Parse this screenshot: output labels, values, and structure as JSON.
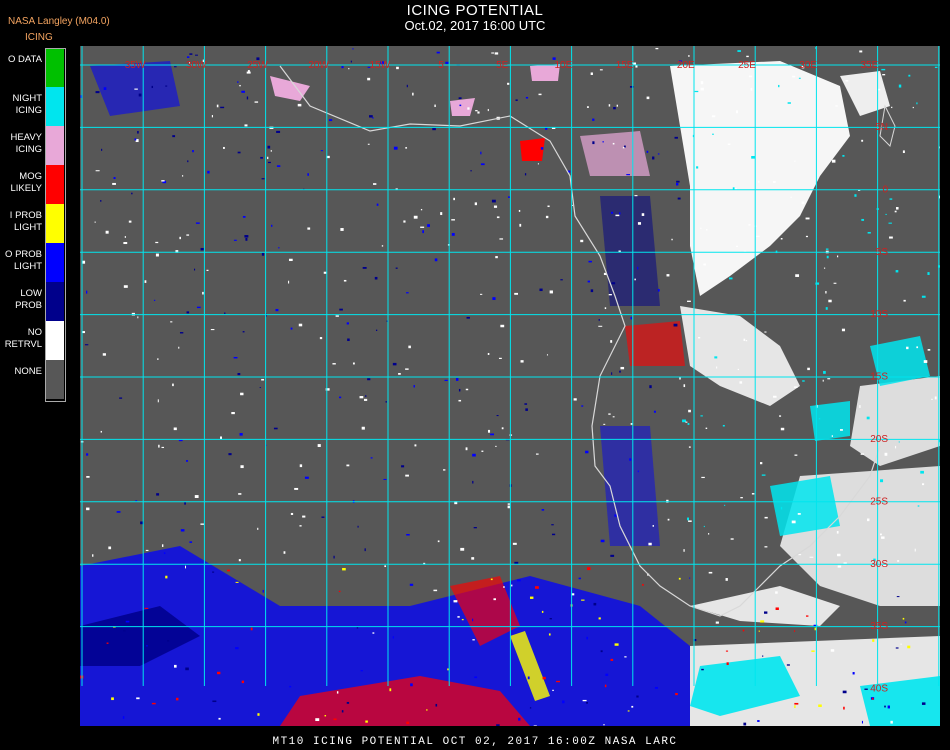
{
  "header": {
    "title": "ICING POTENTIAL",
    "subtitle": "Oct.02, 2017 16:00 UTC",
    "brand": "NASA Langley (M04.0)",
    "product": "ICING"
  },
  "legend": [
    {
      "label": "O DATA",
      "color": "#00c000"
    },
    {
      "label": "NIGHT\nICING",
      "color": "#00e5ee"
    },
    {
      "label": "HEAVY\nICING",
      "color": "#e8a8d8"
    },
    {
      "label": "MOG\nLIKELY",
      "color": "#ff0000"
    },
    {
      "label": "I PROB\nLIGHT",
      "color": "#ffff00"
    },
    {
      "label": "O PROB\nLIGHT",
      "color": "#0000ff"
    },
    {
      "label": "LOW\nPROB",
      "color": "#00008b"
    },
    {
      "label": "NO\nRETRVL",
      "color": "#ffffff"
    },
    {
      "label": "NONE",
      "color": "#575757"
    }
  ],
  "map": {
    "background": "#575757",
    "grid_color": "#00e5ee",
    "label_color": "#cc2222",
    "top_labels": [
      "35W",
      "30W",
      "25W",
      "20W",
      "15W",
      "5",
      "5E",
      "10E",
      "15E",
      "20E",
      "25E",
      "30E",
      "35E"
    ],
    "right_labels": [
      "5N",
      "0",
      "5S",
      "10S",
      "15S",
      "20S",
      "25S",
      "30S",
      "35S",
      "40S"
    ]
  },
  "footer": "MT10  ICING POTENTIAL   OCT 02, 2017 16:00Z   NASA LARC"
}
